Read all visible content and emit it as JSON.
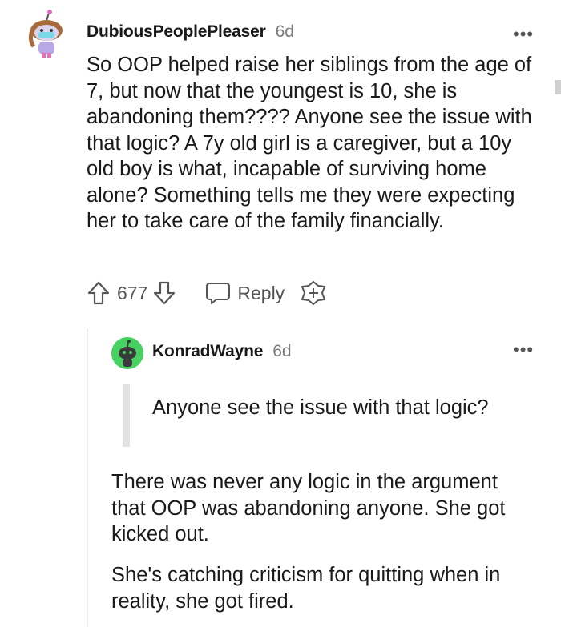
{
  "comments": [
    {
      "username": "DubiousPeoplePleaser",
      "timestamp": "6d",
      "body": "So OOP helped raise her siblings from the age of 7, but now that the youngest is 10, she is abandoning them???? Anyone see the issue with that logic? A 7y old girl is a caregiver, but a 10y old boy is what, incapable of surviving home alone? Something tells me they were expecting her to take care of the family financially.",
      "votes": "677",
      "reply_label": "Reply",
      "more_label": "•••"
    },
    {
      "username": "KonradWayne",
      "timestamp": "6d",
      "quote": "Anyone see the issue with that logic?",
      "paragraphs": [
        "There was never any logic in the argument that OOP was abandoning anyone. She got kicked out.",
        "She's catching criticism for quitting when in reality, she got fired."
      ],
      "more_label": "•••"
    }
  ],
  "icons": {
    "avatar1": "snoo-avatar-icon",
    "avatar2": "snoo-avatar-icon",
    "upvote": "upvote-arrow-icon",
    "downvote": "downvote-arrow-icon",
    "reply": "speech-bubble-icon",
    "award": "award-plus-icon"
  },
  "colors": {
    "accent_green": "#46d160",
    "text": "#1a1a1b",
    "muted": "#7c7c7c"
  }
}
